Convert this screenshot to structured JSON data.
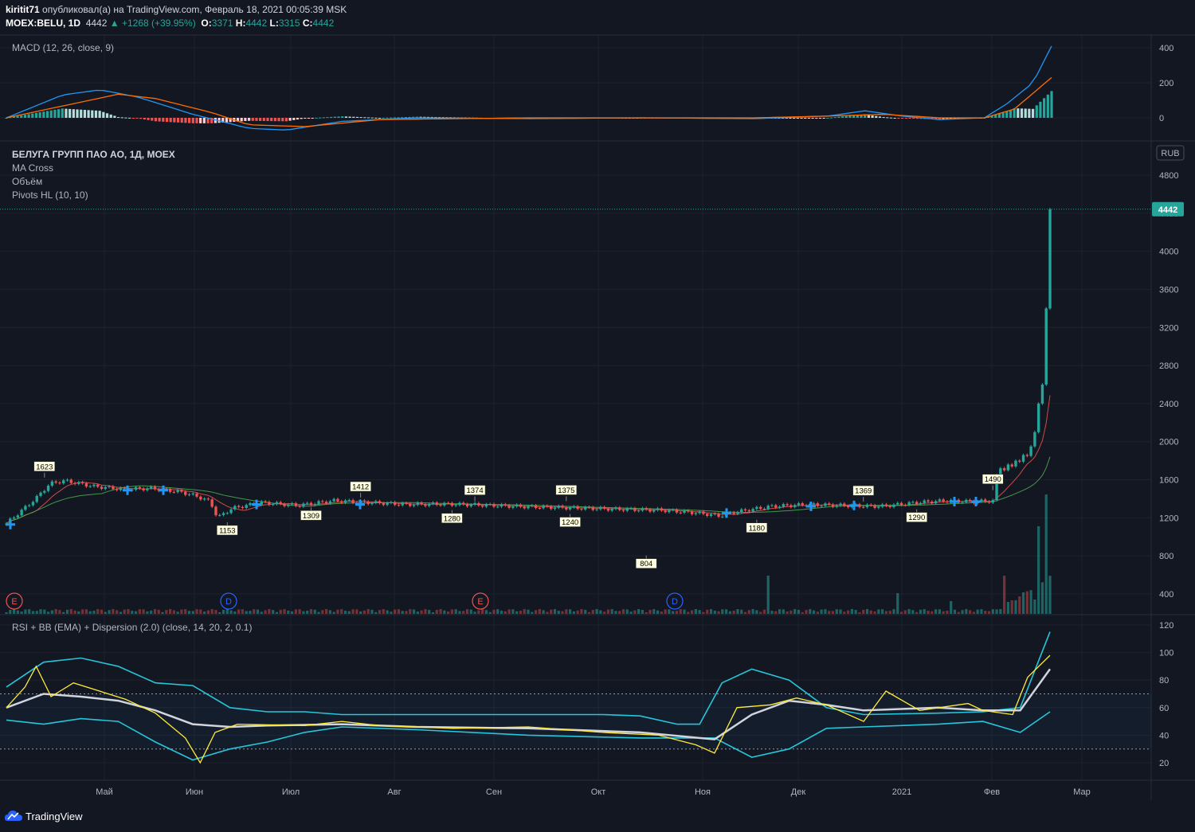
{
  "header": {
    "author": "kiritit71",
    "published": "опубликовал(а) на TradingView.com, Февраль 18, 2021 00:05:39 MSK",
    "symbol": "MOEX:BELU, 1D",
    "last": "4442",
    "change": "+1268 (+39.95%)",
    "o": "3371",
    "h": "4442",
    "l": "3315",
    "c": "4442"
  },
  "panes": {
    "macd_label": "MACD (12, 26, close, 9)",
    "main_title": "БЕЛУГА ГРУПП ПАО АО, 1Д, MOEX",
    "ma_label": "MA Cross",
    "vol_label": "Объём",
    "pivots_label": "Pivots HL (10, 10)",
    "rsi_label": "RSI + BB (EMA) + Dispersion (2.0) (close, 14, 20, 2, 0.1)",
    "currency": "RUB",
    "last_price": "4442"
  },
  "brand": "TradingView",
  "colors": {
    "bg": "#131722",
    "up": "#26a69a",
    "down": "#ef5350",
    "accent": "#2962ff"
  },
  "chart_data": [
    {
      "type": "bar",
      "title": "MACD (12, 26, close, 9)",
      "y_ticks": [
        0,
        200,
        400
      ],
      "ylim": [
        -75,
        420
      ],
      "series": [
        {
          "name": "MACD",
          "color": "#2196f3",
          "x": [
            0,
            15,
            25,
            35,
            50,
            65,
            75,
            90,
            110,
            140,
            170,
            200,
            220,
            230,
            240,
            250,
            262,
            268,
            275,
            280
          ],
          "values": [
            0,
            130,
            160,
            120,
            20,
            -60,
            -70,
            -20,
            0,
            -5,
            0,
            -5,
            10,
            40,
            10,
            -10,
            0,
            80,
            200,
            410
          ]
        },
        {
          "name": "Signal",
          "color": "#ff6d00",
          "x": [
            0,
            20,
            30,
            40,
            55,
            65,
            80,
            100,
            140,
            200,
            220,
            235,
            250,
            262,
            270,
            280
          ],
          "values": [
            0,
            90,
            135,
            110,
            30,
            -40,
            -50,
            -10,
            0,
            0,
            10,
            20,
            0,
            0,
            50,
            230
          ]
        }
      ]
    },
    {
      "type": "candlestick",
      "x_ticks": [
        "Май",
        "Июн",
        "Июл",
        "Авг",
        "Сен",
        "Окт",
        "Ноя",
        "Дек",
        "2021",
        "Фев",
        "Мар"
      ],
      "y_ticks": [
        400,
        800,
        1200,
        1600,
        2000,
        2400,
        2800,
        3200,
        3600,
        4000,
        4400,
        4800
      ],
      "ylim": [
        200,
        4950
      ],
      "pivots": [
        {
          "x": 10,
          "value": 1623,
          "kind": "high"
        },
        {
          "x": 58,
          "value": 1153,
          "kind": "low"
        },
        {
          "x": 93,
          "value": 1412,
          "kind": "high"
        },
        {
          "x": 80,
          "value": 1309,
          "kind": "low"
        },
        {
          "x": 123,
          "value": 1374,
          "kind": "high"
        },
        {
          "x": 117,
          "value": 1280,
          "kind": "low"
        },
        {
          "x": 147,
          "value": 1375,
          "kind": "high"
        },
        {
          "x": 148,
          "value": 1240,
          "kind": "low"
        },
        {
          "x": 168,
          "value": 804,
          "kind": "low"
        },
        {
          "x": 197,
          "value": 1180,
          "kind": "low"
        },
        {
          "x": 225,
          "value": 1369,
          "kind": "high"
        },
        {
          "x": 239,
          "value": 1290,
          "kind": "low"
        },
        {
          "x": 259,
          "value": 1490,
          "kind": "high"
        }
      ],
      "events": [
        {
          "x": 0,
          "label": "E"
        },
        {
          "x": 64,
          "label": "D"
        },
        {
          "x": 139,
          "label": "E"
        },
        {
          "x": 196,
          "label": "D"
        }
      ],
      "last_value": 4442
    },
    {
      "type": "line",
      "title": "RSI + BB (EMA) + Dispersion (2.0) (close, 14, 20, 2, 0.1)",
      "y_ticks": [
        20,
        40,
        60,
        80,
        100,
        120
      ],
      "ylim": [
        10,
        124
      ],
      "levels": [
        70,
        30
      ]
    }
  ]
}
